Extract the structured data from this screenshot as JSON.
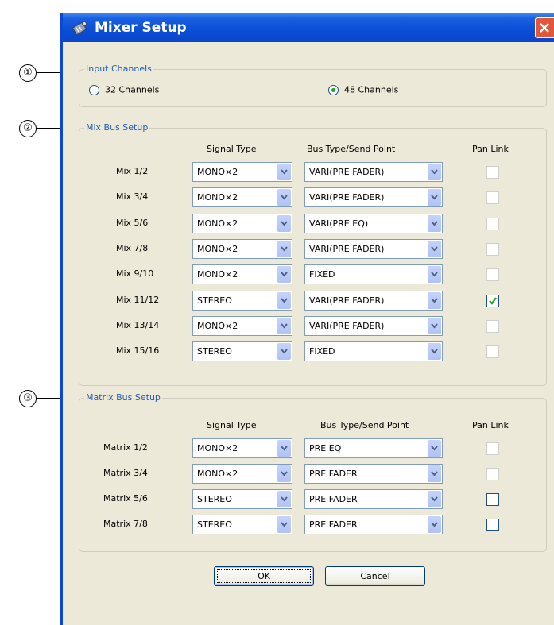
{
  "callouts": [
    "①",
    "②",
    "③"
  ],
  "window": {
    "title": "Mixer Setup",
    "icon": "mixer-app-icon",
    "close_icon": "close-icon"
  },
  "input_channels": {
    "label": "Input Channels",
    "options": [
      {
        "label": "32 Channels",
        "selected": false
      },
      {
        "label": "48 Channels",
        "selected": true
      }
    ]
  },
  "mix_bus": {
    "label": "Mix Bus Setup",
    "headers": {
      "signal": "Signal Type",
      "bus": "Bus Type/Send Point",
      "pan": "Pan Link"
    },
    "rows": [
      {
        "name": "Mix 1/2",
        "signal": "MONO×2",
        "bus": "VARI(PRE FADER)",
        "pan_enabled": false,
        "pan_checked": false
      },
      {
        "name": "Mix 3/4",
        "signal": "MONO×2",
        "bus": "VARI(PRE FADER)",
        "pan_enabled": false,
        "pan_checked": false
      },
      {
        "name": "Mix 5/6",
        "signal": "MONO×2",
        "bus": "VARI(PRE EQ)",
        "pan_enabled": false,
        "pan_checked": false
      },
      {
        "name": "Mix 7/8",
        "signal": "MONO×2",
        "bus": "VARI(PRE FADER)",
        "pan_enabled": false,
        "pan_checked": false
      },
      {
        "name": "Mix 9/10",
        "signal": "MONO×2",
        "bus": "FIXED",
        "pan_enabled": false,
        "pan_checked": false
      },
      {
        "name": "Mix 11/12",
        "signal": "STEREO",
        "bus": "VARI(PRE FADER)",
        "pan_enabled": true,
        "pan_checked": true
      },
      {
        "name": "Mix 13/14",
        "signal": "MONO×2",
        "bus": "VARI(PRE FADER)",
        "pan_enabled": false,
        "pan_checked": false
      },
      {
        "name": "Mix 15/16",
        "signal": "STEREO",
        "bus": "FIXED",
        "pan_enabled": false,
        "pan_checked": false
      }
    ]
  },
  "matrix_bus": {
    "label": "Matrix Bus Setup",
    "headers": {
      "signal": "Signal Type",
      "bus": "Bus Type/Send Point",
      "pan": "Pan Link"
    },
    "rows": [
      {
        "name": "Matrix 1/2",
        "signal": "MONO×2",
        "bus": "PRE EQ",
        "pan_enabled": false,
        "pan_checked": false
      },
      {
        "name": "Matrix 3/4",
        "signal": "MONO×2",
        "bus": "PRE FADER",
        "pan_enabled": false,
        "pan_checked": false
      },
      {
        "name": "Matrix 5/6",
        "signal": "STEREO",
        "bus": "PRE FADER",
        "pan_enabled": true,
        "pan_checked": false
      },
      {
        "name": "Matrix 7/8",
        "signal": "STEREO",
        "bus": "PRE FADER",
        "pan_enabled": true,
        "pan_checked": false
      }
    ]
  },
  "buttons": {
    "ok": "OK",
    "cancel": "Cancel"
  },
  "colors": {
    "titlebar": "#0a4ed6",
    "group_label": "#1f5bb8",
    "dialog_bg": "#ece9d8",
    "check": "#21a121"
  }
}
